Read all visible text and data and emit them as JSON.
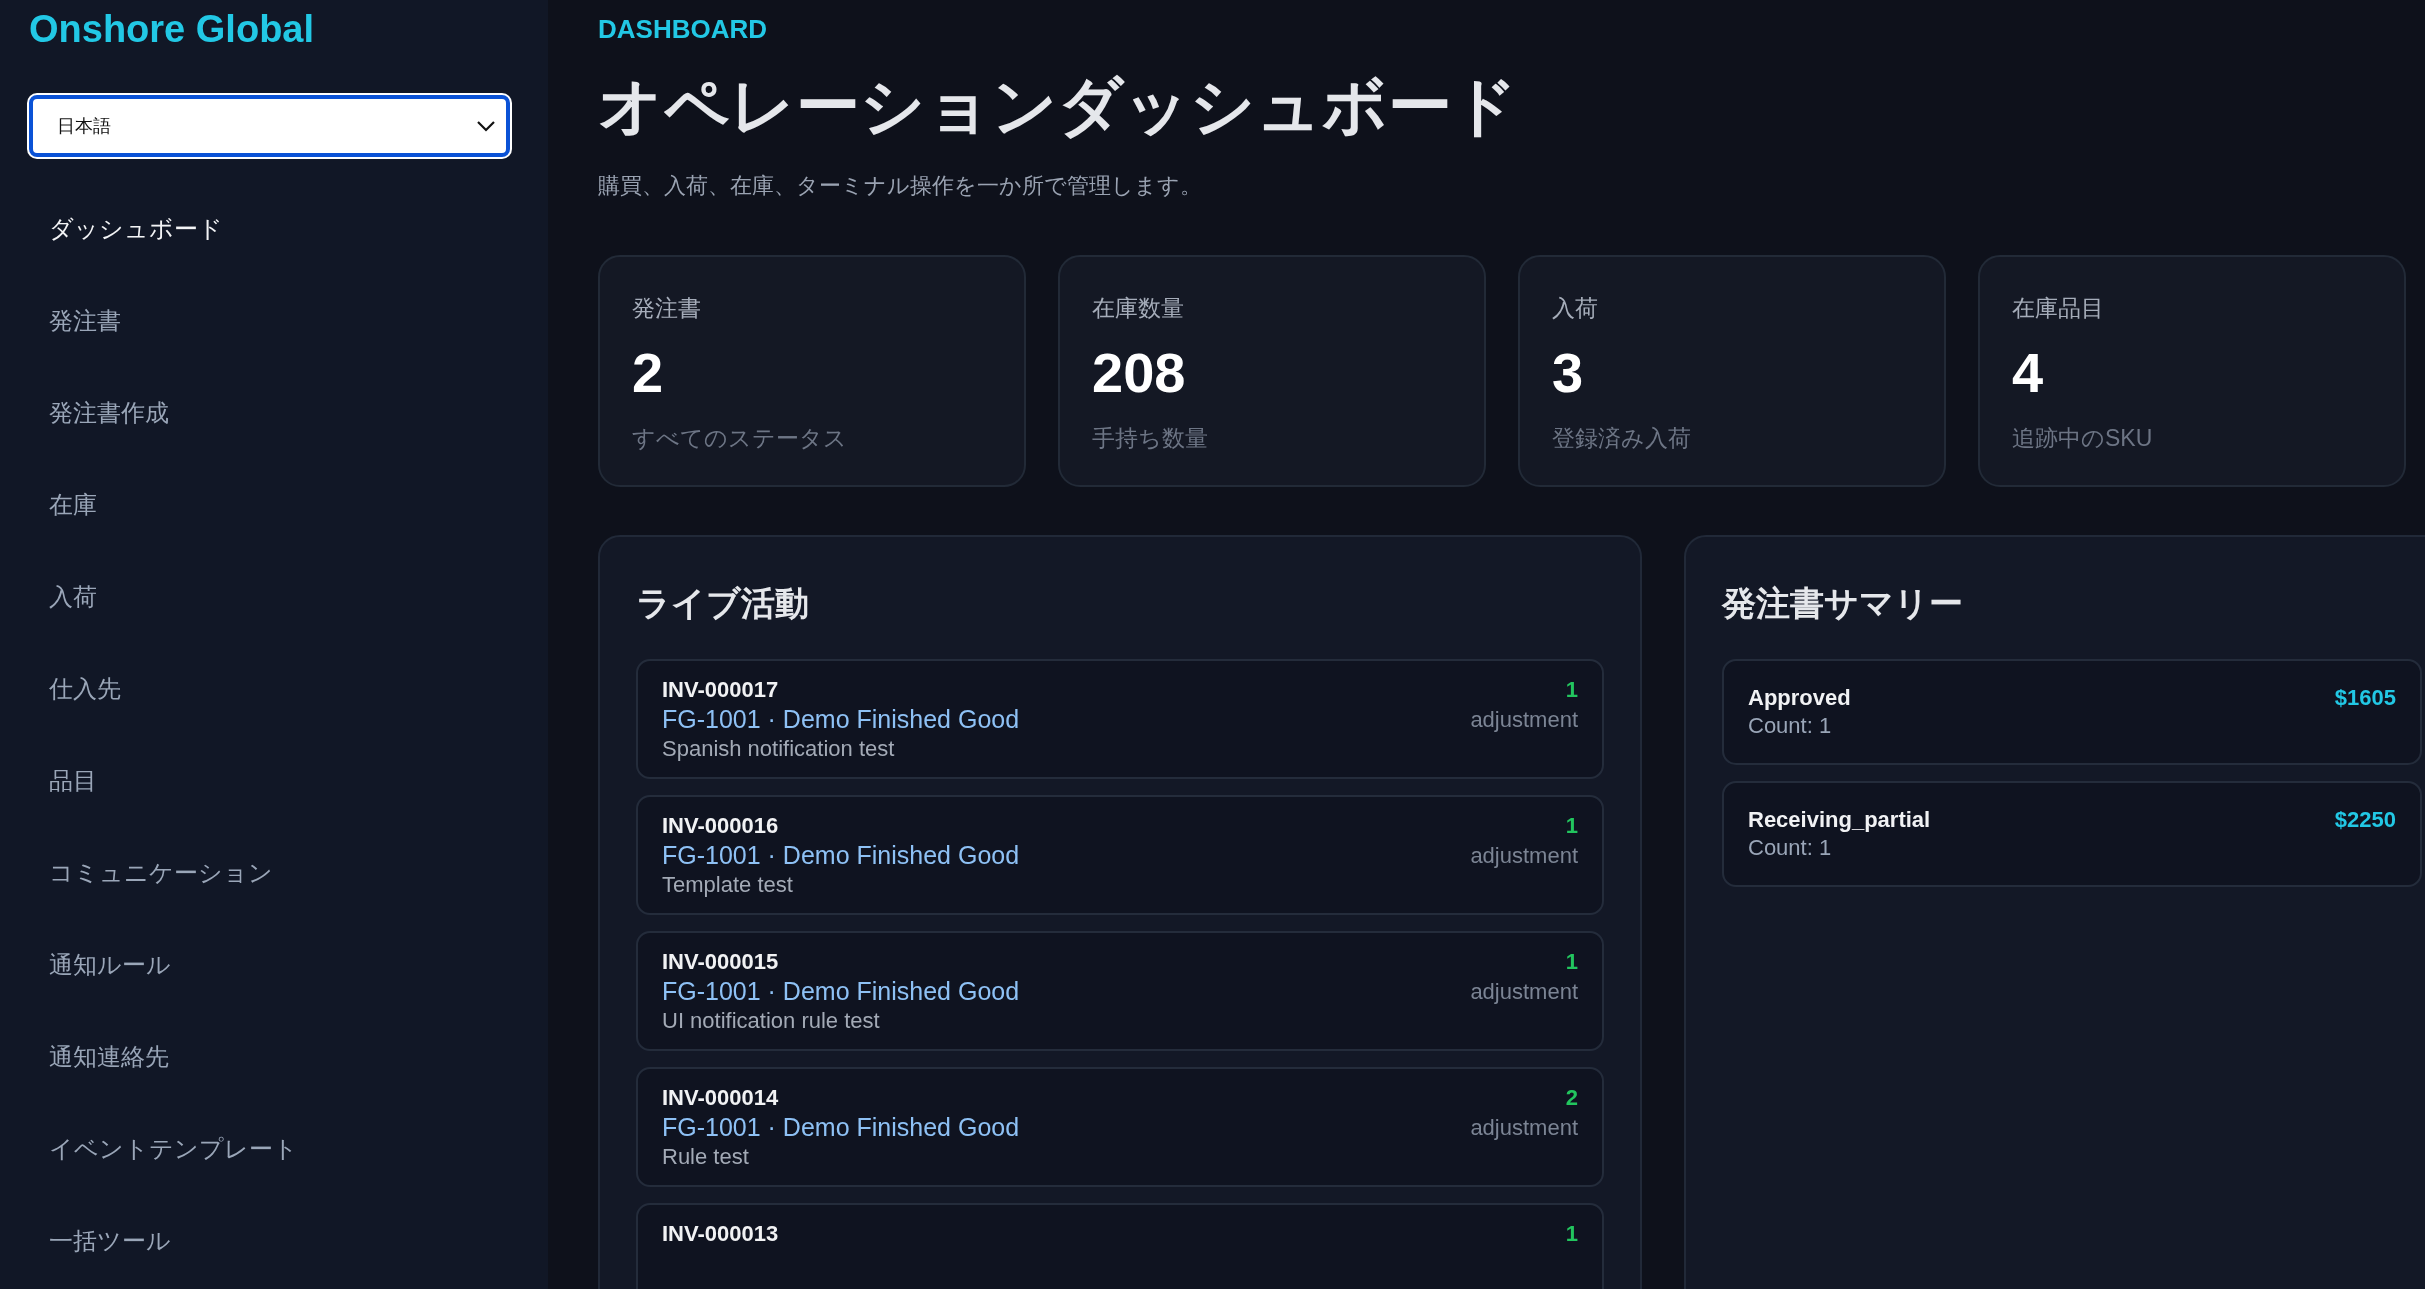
{
  "sidebar": {
    "brand": "Onshore Global",
    "language_select": {
      "value": "日本語"
    },
    "items": [
      {
        "label": "ダッシュボード",
        "selected": true
      },
      {
        "label": "発注書",
        "selected": false
      },
      {
        "label": "発注書作成",
        "selected": false
      },
      {
        "label": "在庫",
        "selected": false
      },
      {
        "label": "入荷",
        "selected": false
      },
      {
        "label": "仕入先",
        "selected": false
      },
      {
        "label": "品目",
        "selected": false
      },
      {
        "label": "コミュニケーション",
        "selected": false
      },
      {
        "label": "通知ルール",
        "selected": false
      },
      {
        "label": "通知連絡先",
        "selected": false
      },
      {
        "label": "イベントテンプレート",
        "selected": false
      },
      {
        "label": "一括ツール",
        "selected": false
      }
    ]
  },
  "header": {
    "eyebrow": "DASHBOARD",
    "title": "オペレーションダッシュボード",
    "subtitle": "購買、入荷、在庫、ターミナル操作を一か所で管理します。"
  },
  "stats": [
    {
      "label": "発注書",
      "value": "2",
      "note": "すべてのステータス"
    },
    {
      "label": "在庫数量",
      "value": "208",
      "note": "手持ち数量"
    },
    {
      "label": "入荷",
      "value": "3",
      "note": "登録済み入荷"
    },
    {
      "label": "在庫品目",
      "value": "4",
      "note": "追跡中のSKU"
    }
  ],
  "live_activity": {
    "title": "ライブ活動",
    "items": [
      {
        "ref": "INV-000017",
        "item": "FG-1001 · Demo Finished Good",
        "note": "Spanish notification test",
        "qty": "1",
        "type": "adjustment"
      },
      {
        "ref": "INV-000016",
        "item": "FG-1001 · Demo Finished Good",
        "note": "Template test",
        "qty": "1",
        "type": "adjustment"
      },
      {
        "ref": "INV-000015",
        "item": "FG-1001 · Demo Finished Good",
        "note": "UI notification rule test",
        "qty": "1",
        "type": "adjustment"
      },
      {
        "ref": "INV-000014",
        "item": "FG-1001 · Demo Finished Good",
        "note": "Rule test",
        "qty": "2",
        "type": "adjustment"
      },
      {
        "ref": "INV-000013",
        "qty": "1"
      }
    ]
  },
  "po_summary": {
    "title": "発注書サマリー",
    "items": [
      {
        "status": "Approved",
        "count": "Count: 1",
        "amount": "$1605"
      },
      {
        "status": "Receiving_partial",
        "count": "Count: 1",
        "amount": "$2250"
      }
    ]
  }
}
